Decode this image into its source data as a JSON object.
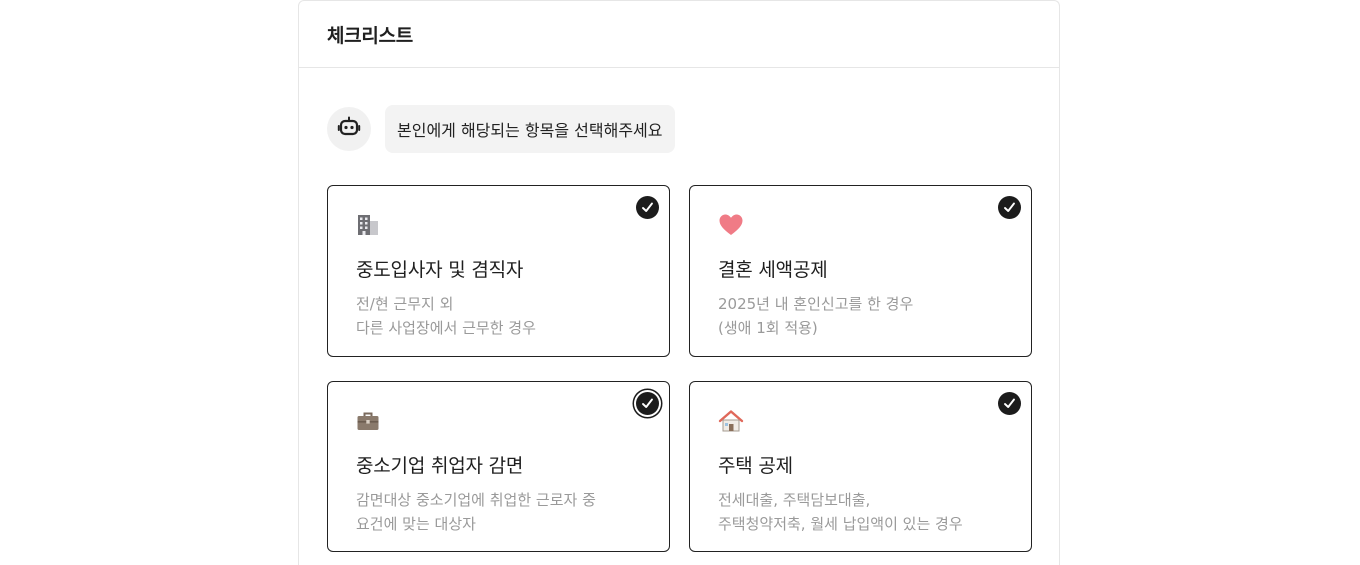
{
  "header": {
    "title": "체크리스트"
  },
  "assistant": {
    "avatar_icon": "robot-icon",
    "message": "본인에게 해당되는 항목을 선택해주세요"
  },
  "options": [
    {
      "icon": "office-building-icon",
      "title": "중도입사자 및 겸직자",
      "desc_line1": "전/현 근무지 외",
      "desc_line2": "다른 사업장에서 근무한 경우",
      "checked": true
    },
    {
      "icon": "heart-icon",
      "title": "결혼 세액공제",
      "desc_line1": "2025년 내 혼인신고를 한 경우",
      "desc_line2": "(생애 1회 적용)",
      "checked": true
    },
    {
      "icon": "briefcase-icon",
      "title": "중소기업 취업자 감면",
      "desc_line1": "감면대상 중소기업에 취업한 근로자 중",
      "desc_line2": "요건에 맞는 대상자",
      "checked": true
    },
    {
      "icon": "house-icon",
      "title": "주택 공제",
      "desc_line1": "전세대출, 주택담보대출,",
      "desc_line2": "주택청약저축, 월세 납입액이 있는 경우",
      "checked": true
    }
  ],
  "colors": {
    "card_border": "#222222",
    "check_fill": "#1c1c1c",
    "desc_text": "#9a9a9a",
    "heart": "#f07b86"
  }
}
